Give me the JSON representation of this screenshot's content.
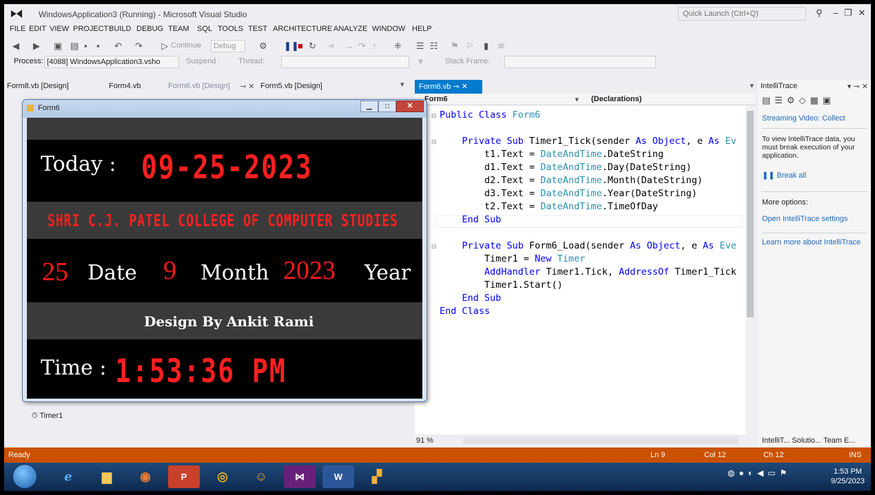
{
  "window": {
    "title": "WindowsApplication3 (Running) - Microsoft Visual Studio",
    "quick_launch_placeholder": "Quick Launch (Ctrl+Q)"
  },
  "menu": [
    "FILE",
    "EDIT",
    "VIEW",
    "PROJECT",
    "BUILD",
    "DEBUG",
    "TEAM",
    "SQL",
    "TOOLS",
    "TEST",
    "ARCHITECTURE",
    "ANALYZE",
    "WINDOW",
    "HELP"
  ],
  "toolbar": {
    "continue_label": "Continue",
    "config_value": "Debug",
    "process_label": "Process:",
    "process_value": "[4088] WindowsApplication3.vsho",
    "suspend_label": "Suspend",
    "thread_label": "Thread:",
    "stack_frame_label": "Stack Frame:"
  },
  "doc_tabs": [
    "Form8.vb [Design]",
    "Form4.vb",
    "Form6.vb [Design]",
    "Form5.vb [Design]"
  ],
  "designer": {
    "tray_component": "Timer1"
  },
  "form6": {
    "title": "Form6",
    "today_label": "Today :",
    "today_value": "09-25-2023",
    "college_banner": "SHRI C.J. PATEL COLLEGE OF COMPUTER STUDIES",
    "day_value": "25",
    "day_label": "Date",
    "month_value": "9",
    "month_label": "Month",
    "year_value": "2023",
    "year_label": "Year",
    "design_by": "Design By Ankit Rami",
    "time_label": "Time :",
    "time_value": "1:53:36 PM"
  },
  "code_editor": {
    "tab_label": "Form6.vb",
    "nav_class": "Form6",
    "nav_member": "(Declarations)",
    "zoom": "91 %",
    "lines": [
      [
        {
          "t": "Public Class ",
          "c": "kw"
        },
        {
          "t": "Form6",
          "c": "ty"
        }
      ],
      [],
      [
        {
          "t": "    Private Sub ",
          "c": "kw"
        },
        {
          "t": "Timer1_Tick(sender ",
          "c": ""
        },
        {
          "t": "As ",
          "c": "kw"
        },
        {
          "t": "Object",
          "c": "kw"
        },
        {
          "t": ", e ",
          "c": ""
        },
        {
          "t": "As ",
          "c": "kw"
        },
        {
          "t": "Ev",
          "c": "ty"
        }
      ],
      [
        {
          "t": "        t1.Text = ",
          "c": ""
        },
        {
          "t": "DateAndTime",
          "c": "ty"
        },
        {
          "t": ".DateString",
          "c": ""
        }
      ],
      [
        {
          "t": "        d1.Text = ",
          "c": ""
        },
        {
          "t": "DateAndTime",
          "c": "ty"
        },
        {
          "t": ".Day(DateString)",
          "c": ""
        }
      ],
      [
        {
          "t": "        d2.Text = ",
          "c": ""
        },
        {
          "t": "DateAndTime",
          "c": "ty"
        },
        {
          "t": ".Month(DateString)",
          "c": ""
        }
      ],
      [
        {
          "t": "        d3.Text = ",
          "c": ""
        },
        {
          "t": "DateAndTime",
          "c": "ty"
        },
        {
          "t": ".Year(DateString)",
          "c": ""
        }
      ],
      [
        {
          "t": "        t2.Text = ",
          "c": ""
        },
        {
          "t": "DateAndTime",
          "c": "ty"
        },
        {
          "t": ".TimeOfDay",
          "c": ""
        }
      ],
      [
        {
          "t": "    End Sub",
          "c": "kw"
        }
      ],
      [],
      [
        {
          "t": "    Private Sub ",
          "c": "kw"
        },
        {
          "t": "Form6_Load(sender ",
          "c": ""
        },
        {
          "t": "As ",
          "c": "kw"
        },
        {
          "t": "Object",
          "c": "kw"
        },
        {
          "t": ", e ",
          "c": ""
        },
        {
          "t": "As ",
          "c": "kw"
        },
        {
          "t": "Eve",
          "c": "ty"
        }
      ],
      [
        {
          "t": "        Timer1 = ",
          "c": ""
        },
        {
          "t": "New ",
          "c": "kw"
        },
        {
          "t": "Timer",
          "c": "ty"
        }
      ],
      [
        {
          "t": "        AddHandler ",
          "c": "kw"
        },
        {
          "t": "Timer1.Tick, ",
          "c": ""
        },
        {
          "t": "AddressOf ",
          "c": "kw"
        },
        {
          "t": "Timer1_Tick",
          "c": ""
        }
      ],
      [
        {
          "t": "        Timer1.Start()",
          "c": ""
        }
      ],
      [
        {
          "t": "    End Sub",
          "c": "kw"
        }
      ],
      [
        {
          "t": "End Class",
          "c": "kw"
        }
      ]
    ]
  },
  "intellitrace": {
    "title": "IntelliTrace",
    "streaming_video": "Streaming Video: Collect",
    "description": "To view IntelliTrace data, you must break execution of your application.",
    "break_all": "Break all",
    "more_options": "More options:",
    "open_settings": "Open IntelliTrace settings",
    "learn_more": "Learn more about IntelliTrace",
    "bottom_tabs": "IntelliT...   Solutio...   Team E..."
  },
  "statusbar": {
    "state": "Ready",
    "line": "Ln 9",
    "col": "Col 12",
    "ch": "Ch 12",
    "mode": "INS"
  },
  "taskbar": {
    "time": "1:53 PM",
    "date": "9/25/2023"
  },
  "colors": {
    "status_bar": "#ca5100",
    "accent": "#007acc",
    "digital_red": "#ff2020"
  }
}
